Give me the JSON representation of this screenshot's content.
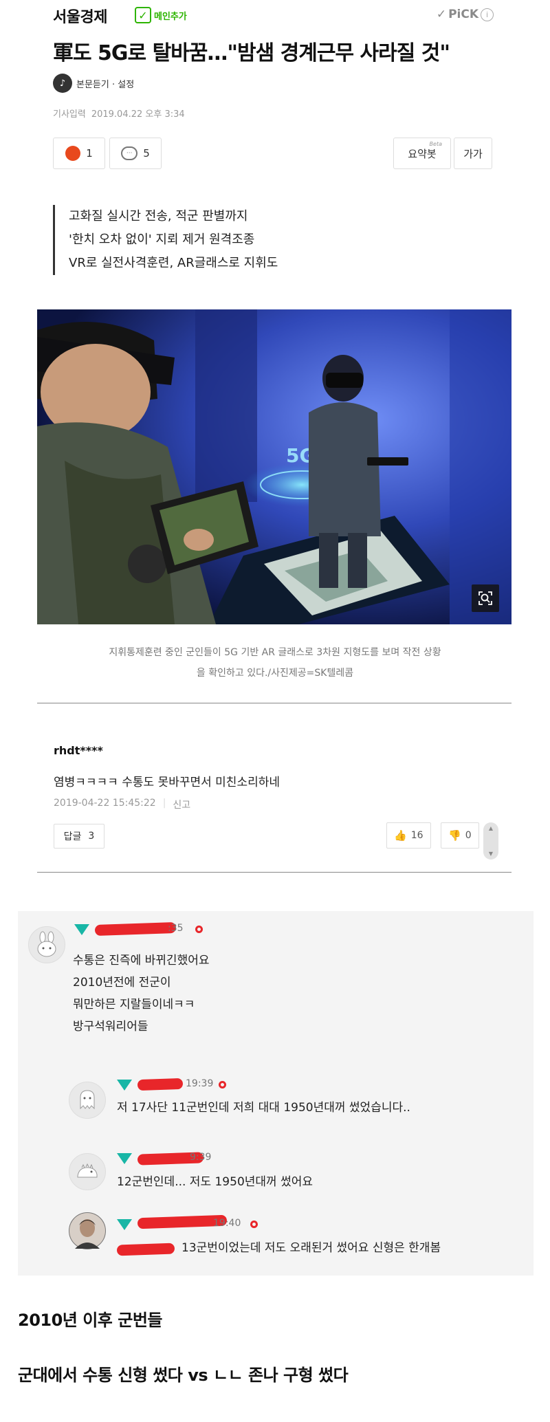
{
  "header": {
    "logo": "서울경제",
    "main_add_label": "메인추가",
    "pick_label": "PiCK"
  },
  "article": {
    "title": "軍도 5G로 탈바꿈…\"밤샘 경계근무 사라질 것\"",
    "listen_label": "본문듣기 · 설정",
    "date_label": "기사입력",
    "date_value": "2019.04.22 오후 3:34",
    "actions": {
      "reaction_count": "1",
      "comment_count": "5",
      "summary_bot": "요약봇",
      "summary_beta": "Beta",
      "font_size": "가가"
    },
    "summary_lines": [
      "고화질 실시간 전송, 적군 판별까지",
      "'한치 오차 없이' 지뢰 제거 원격조종",
      "VR로 실전사격훈련, AR글래스로 지휘도"
    ],
    "photo_overlay_text": "5G",
    "caption": [
      "지휘통제훈련 중인 군인들이 5G 기반 AR 글래스로 3차원 지형도를 보며 작전 상황",
      "을 확인하고 있다./사진제공=SK텔레콤"
    ]
  },
  "comment": {
    "user": "rhdt****",
    "text": "염병ㅋㅋㅋㅋ 수통도 못바꾸면서 미친소리하네",
    "date": "2019-04-22 15:45:22",
    "report": "신고",
    "reply_label": "답글",
    "reply_count": "3",
    "likes": "16",
    "dislikes": "0"
  },
  "card": {
    "main": {
      "time": ":35",
      "lines": [
        "수통은 진즉에 바뀌긴했어요",
        "2010년전에 전군이",
        "뭐만하믄 지랄들이네ㅋㅋ",
        "방구석워리어들"
      ]
    },
    "replies": [
      {
        "time": "19:39",
        "text": "저 17사단 11군번인데 저희 대대 1950년대꺼 썼었습니다.."
      },
      {
        "time": "9:39",
        "text": "12군번인데... 저도 1950년대꺼 썼어요"
      },
      {
        "time": "19:40",
        "text": "13군번이었는데 저도 오래된거 썼어요 신형은 한개봄"
      }
    ]
  },
  "bottom": {
    "line1": "2010년 이후 군번들",
    "line2": "군대에서 수통 신형 썼다 vs ㄴㄴ 존나 구형 썼다"
  },
  "colors": {
    "brand_green": "#2db400",
    "gem_teal": "#18b6a6",
    "redact_red": "#e8262a"
  }
}
